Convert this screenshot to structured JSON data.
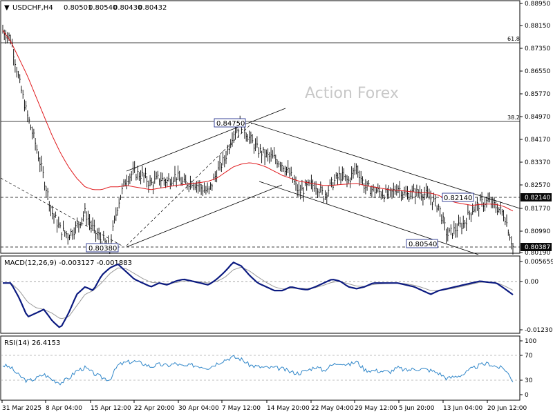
{
  "header": {
    "symbol_tf": "USDCHF,H4",
    "open": "0.80501",
    "high": "0.80540",
    "low": "0.80430",
    "close": "0.80432"
  },
  "watermark": "Action Forex",
  "colors": {
    "candle": "#000000",
    "ma": "#e0191c",
    "macd_main": "#0b1a80",
    "macd_signal": "#9a9a9a",
    "rsi": "#2f86c9",
    "price_tag_bg": "#0a0a0a",
    "level_label_border": "#0b1a80"
  },
  "chart_data": [
    {
      "type": "candlestick",
      "title": "USDCHF,H4",
      "ylim": [
        0.8019,
        0.8895
      ],
      "y_ticks": [
        "0.88950",
        "0.88150",
        "0.87350",
        "0.86550",
        "0.85770",
        "0.84970",
        "0.84170",
        "0.83370",
        "0.82570",
        "0.81770",
        "0.80990",
        "0.80190"
      ],
      "x_ticks": [
        "31 Mar 2025",
        "8 Apr 04:00",
        "15 Apr 12:00",
        "22 Apr 20:00",
        "30 Apr 04:00",
        "7 May 12:00",
        "14 May 20:00",
        "22 May 04:00",
        "29 May 12:00",
        "5 Jun 20:00",
        "13 Jun 04:00",
        "20 Jun 12:00"
      ],
      "close_path": [
        0.88,
        0.877,
        0.862,
        0.85,
        0.84,
        0.828,
        0.816,
        0.81,
        0.808,
        0.811,
        0.816,
        0.81,
        0.806,
        0.804,
        0.819,
        0.828,
        0.83,
        0.829,
        0.826,
        0.828,
        0.827,
        0.829,
        0.826,
        0.827,
        0.825,
        0.823,
        0.83,
        0.835,
        0.844,
        0.847,
        0.842,
        0.838,
        0.836,
        0.835,
        0.833,
        0.829,
        0.823,
        0.825,
        0.826,
        0.822,
        0.826,
        0.829,
        0.827,
        0.832,
        0.825,
        0.824,
        0.823,
        0.822,
        0.825,
        0.822,
        0.823,
        0.823,
        0.821,
        0.818,
        0.808,
        0.81,
        0.812,
        0.817,
        0.819,
        0.82,
        0.818,
        0.815,
        0.804
      ],
      "ma_path": [
        0.88,
        0.876,
        0.87,
        0.864,
        0.857,
        0.85,
        0.843,
        0.837,
        0.832,
        0.828,
        0.825,
        0.824,
        0.824,
        0.825,
        0.825,
        0.8255,
        0.825,
        0.8245,
        0.824,
        0.8245,
        0.825,
        0.8255,
        0.8258,
        0.8262,
        0.8265,
        0.827,
        0.828,
        0.83,
        0.832,
        0.833,
        0.8335,
        0.833,
        0.832,
        0.8305,
        0.829,
        0.828,
        0.827,
        0.8265,
        0.826,
        0.8255,
        0.8255,
        0.8258,
        0.826,
        0.8262,
        0.8255,
        0.825,
        0.8245,
        0.824,
        0.8238,
        0.8235,
        0.8232,
        0.823,
        0.8228,
        0.822,
        0.8205,
        0.8195,
        0.819,
        0.8185,
        0.8188,
        0.819,
        0.8188,
        0.818,
        0.8165
      ],
      "horizontal_levels": [
        {
          "value": 0.876,
          "label": "61.8",
          "style": "solid"
        },
        {
          "value": 0.848,
          "label": "38.2",
          "style": "solid"
        },
        {
          "value": 0.8214,
          "label": "",
          "style": "dashed"
        },
        {
          "value": 0.80387,
          "label": "",
          "style": "dashed"
        }
      ],
      "price_labels": [
        "0.84750",
        "0.80380",
        "0.82140",
        "0.80540"
      ],
      "current_price_tags": [
        {
          "value": 0.8214,
          "text": "0.82140"
        },
        {
          "value": 0.80387,
          "text": "0.80387"
        }
      ]
    },
    {
      "type": "line",
      "title": "MACD(12,26,9) -0.003127 -0.001883",
      "ylim": [
        -0.0124,
        0.0057
      ],
      "y_ticks": [
        "0.005659",
        "0.00",
        "-0.012301"
      ],
      "series": [
        {
          "name": "MACD",
          "values": [
            0.0,
            0.0,
            -0.004,
            -0.009,
            -0.008,
            -0.007,
            -0.01,
            -0.012,
            -0.008,
            -0.003,
            -0.001,
            -0.002,
            0.002,
            0.004,
            0.005,
            0.003,
            0.001,
            0.0,
            -0.001,
            0.0,
            -0.0005,
            0.0005,
            0.001,
            0.0005,
            0.0,
            -0.0005,
            0.001,
            0.003,
            0.0055,
            0.0045,
            0.002,
            0.0,
            -0.001,
            -0.002,
            -0.002,
            -0.001,
            -0.0015,
            -0.0018,
            -0.001,
            0.0,
            0.001,
            0.0005,
            -0.001,
            -0.0015,
            -0.001,
            0.0,
            0.0,
            0.0,
            0.0,
            -0.0005,
            -0.001,
            -0.002,
            -0.003,
            -0.002,
            -0.0015,
            -0.001,
            -0.0005,
            0.0,
            0.0005,
            0.0002,
            0.0,
            -0.0015,
            -0.0031
          ]
        },
        {
          "name": "Signal",
          "values": [
            0.0,
            0.0,
            -0.002,
            -0.005,
            -0.0065,
            -0.007,
            -0.008,
            -0.0095,
            -0.009,
            -0.006,
            -0.003,
            -0.002,
            0.0,
            0.0025,
            0.004,
            0.0038,
            0.0025,
            0.0012,
            0.0002,
            0.0,
            -0.0002,
            0.0001,
            0.0005,
            0.0006,
            0.0003,
            0.0,
            0.0004,
            0.0015,
            0.0035,
            0.0042,
            0.0032,
            0.0016,
            0.0002,
            -0.001,
            -0.0016,
            -0.0014,
            -0.0014,
            -0.0015,
            -0.0012,
            -0.0006,
            0.0002,
            0.0004,
            -0.0002,
            -0.0008,
            -0.0009,
            -0.0004,
            -0.0002,
            -0.0001,
            0.0,
            -0.0002,
            -0.0006,
            -0.0012,
            -0.002,
            -0.002,
            -0.0017,
            -0.0013,
            -0.0008,
            -0.0003,
            0.0002,
            0.0002,
            0.0001,
            -0.0008,
            -0.0019
          ]
        }
      ]
    },
    {
      "type": "line",
      "title": "RSI(14) 26.4153",
      "ylim": [
        0,
        100
      ],
      "y_ticks": [
        "100",
        "70",
        "30",
        "0"
      ],
      "levels": [
        70,
        30
      ],
      "series": [
        {
          "name": "RSI",
          "values": [
            55,
            50,
            35,
            25,
            30,
            38,
            28,
            22,
            30,
            45,
            50,
            40,
            32,
            28,
            55,
            60,
            62,
            58,
            52,
            56,
            54,
            58,
            52,
            55,
            53,
            50,
            58,
            65,
            70,
            66,
            55,
            52,
            50,
            50,
            48,
            42,
            40,
            45,
            52,
            45,
            55,
            60,
            55,
            62,
            46,
            45,
            44,
            42,
            50,
            45,
            48,
            48,
            45,
            40,
            30,
            34,
            38,
            48,
            55,
            58,
            52,
            48,
            26
          ]
        }
      ]
    }
  ]
}
